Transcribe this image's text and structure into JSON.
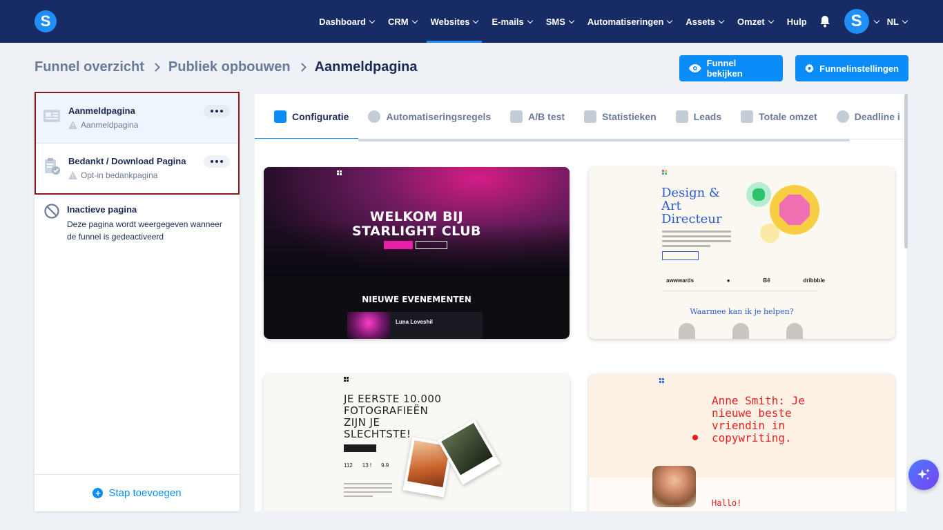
{
  "nav": {
    "items": [
      {
        "label": "Dashboard",
        "has_dropdown": true,
        "active": false
      },
      {
        "label": "CRM",
        "has_dropdown": true,
        "active": false
      },
      {
        "label": "Websites",
        "has_dropdown": true,
        "active": true
      },
      {
        "label": "E-mails",
        "has_dropdown": true,
        "active": false
      },
      {
        "label": "SMS",
        "has_dropdown": true,
        "active": false
      },
      {
        "label": "Automatiseringen",
        "has_dropdown": true,
        "active": false
      },
      {
        "label": "Assets",
        "has_dropdown": true,
        "active": false
      },
      {
        "label": "Omzet",
        "has_dropdown": true,
        "active": false
      },
      {
        "label": "Hulp",
        "has_dropdown": false,
        "active": false
      }
    ],
    "logo_letter": "S",
    "avatar_letter": "S",
    "language": "NL"
  },
  "breadcrumb": {
    "items": [
      "Funnel overzicht",
      "Publiek opbouwen",
      "Aanmeldpagina"
    ]
  },
  "actions": {
    "view_label": "Funnel bekijken",
    "settings_label": "Funnelinstellingen"
  },
  "sidebar": {
    "steps": [
      {
        "title": "Aanmeldpagina",
        "subtitle": "Aanmeldpagina"
      },
      {
        "title": "Bedankt / Download Pagina",
        "subtitle": "Opt-in bedankpagina"
      }
    ],
    "inactive": {
      "title": "Inactieve pagina",
      "description": "Deze pagina wordt weergegeven wanneer de funnel is gedeactiveerd"
    },
    "add_step_label": "Stap toevoegen"
  },
  "tabs": [
    {
      "label": "Configuratie",
      "icon": "sliders-icon",
      "active": true
    },
    {
      "label": "Automatiseringsregels",
      "icon": "bolt-icon",
      "active": false
    },
    {
      "label": "A/B test",
      "icon": "split-icon",
      "active": false
    },
    {
      "label": "Statistieken",
      "icon": "chart-icon",
      "active": false
    },
    {
      "label": "Leads",
      "icon": "users-icon",
      "active": false
    },
    {
      "label": "Totale omzet",
      "icon": "dollar-icon",
      "active": false
    },
    {
      "label": "Deadline i",
      "icon": "clock-icon",
      "active": false
    }
  ],
  "templates": {
    "starlight": {
      "title_line1": "WELKOM BIJ",
      "title_line2": "STARLIGHT CLUB",
      "section": "NIEUWE EVENEMENTEN",
      "event_name": "Luna Loveshil"
    },
    "design": {
      "title_line1": "Design &",
      "title_line2": "Art",
      "title_line3": "Directeur",
      "logos": [
        "awwwards",
        "",
        "Bē",
        "dribbble"
      ],
      "help": "Waarmee kan ik je helpen?"
    },
    "photo": {
      "title_line1": "JE EERSTE 10.000",
      "title_line2": "FOTOGRAFIEËN",
      "title_line3": "ZIJN JE",
      "title_line4": "SLECHTSTE!",
      "stats": [
        "112",
        "13 !",
        "9.9"
      ]
    },
    "copy": {
      "title_line1": "Anne Smith: Je",
      "title_line2": "nieuwe beste",
      "title_line3": "vriendin in",
      "title_line4": "copywriting.",
      "hallo": "Hallo!"
    }
  },
  "colors": {
    "nav_bg": "#172b65",
    "accent": "#0a8df8",
    "selection_border": "#8b1a1a"
  }
}
